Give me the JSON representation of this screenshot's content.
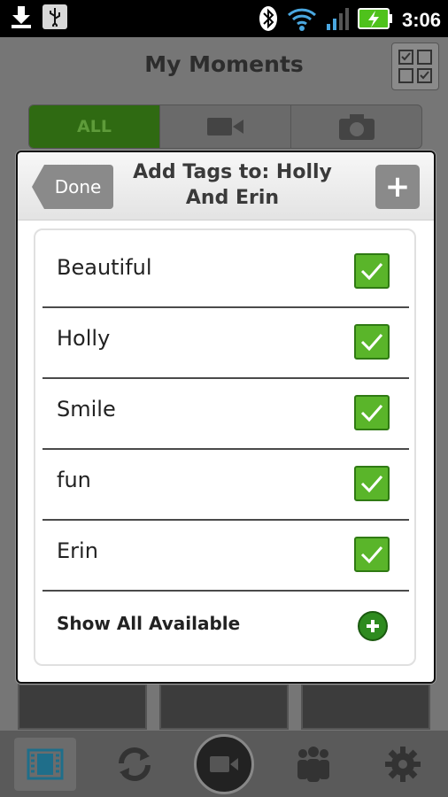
{
  "statusbar": {
    "time": "3:06"
  },
  "app": {
    "title": "My Moments",
    "segments": {
      "all_label": "ALL"
    }
  },
  "dialog": {
    "done_label": "Done",
    "title": "Add Tags to: Holly And Erin",
    "add_label": "+",
    "tags": [
      {
        "label": "Beautiful",
        "checked": true
      },
      {
        "label": "Holly",
        "checked": true
      },
      {
        "label": "Smile",
        "checked": true
      },
      {
        "label": "fun",
        "checked": true
      },
      {
        "label": "Erin",
        "checked": true
      }
    ],
    "show_all_label": "Show All Available"
  },
  "colors": {
    "accent_green": "#5ab52a",
    "status_bar": "#000000",
    "dim_overlay": "#767676"
  },
  "icons": {
    "status": [
      "download-icon",
      "usb-icon",
      "bluetooth-icon",
      "wifi-icon",
      "signal-icon",
      "battery-charging-icon"
    ],
    "bottom_nav": [
      "filmstrip-icon",
      "sync-icon",
      "record-video-icon",
      "people-icon",
      "gear-icon"
    ]
  }
}
